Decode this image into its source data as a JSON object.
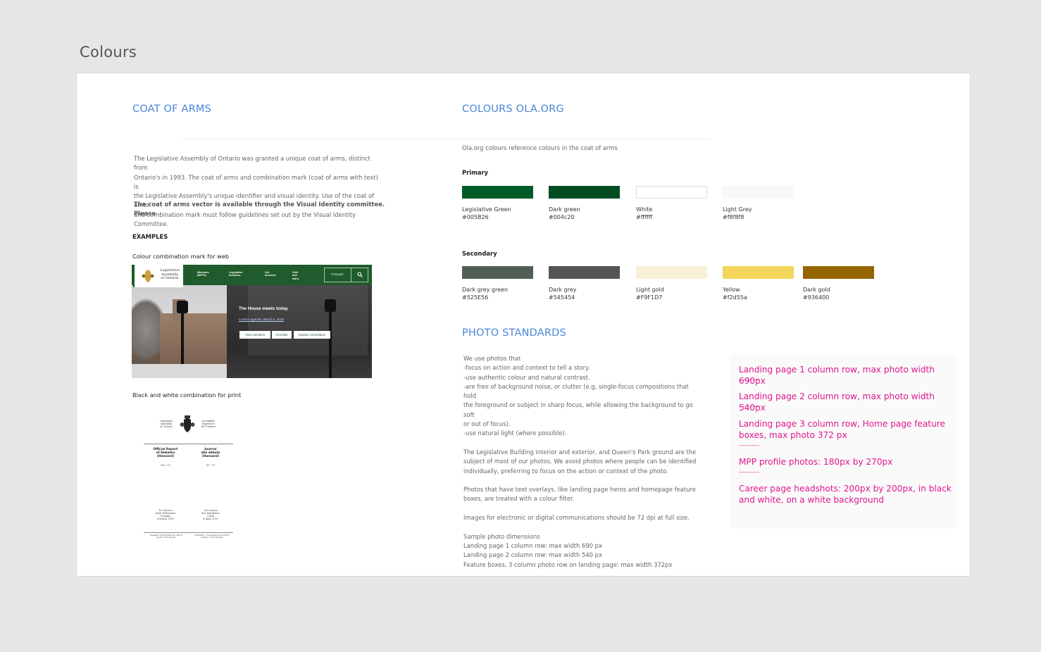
{
  "page": {
    "heading": "Colours"
  },
  "coat_of_arms": {
    "title": "COAT OF ARMS",
    "description": [
      "The Legislative Assembly of Ontario was granted a unique coat of arms, distinct from",
      "Ontario's in 1993. The coat of arms and combination mark (coat of arms with text) is",
      "the Legislative Assembly's unique identifier and visual identity.  Use of the coat of arms",
      "and combination mark must follow guidelines set out by the Visual Identity Committee."
    ],
    "vector_note": "The coat of arms vector is available through the Visual Identity committee. Please",
    "examples_heading": "EXAMPLES",
    "web_caption": "Colour combination mark for web",
    "print_caption": "Black and white combination for print"
  },
  "web_mockup": {
    "logo_lines": [
      "Legislative",
      "Assembly",
      "of Ontario"
    ],
    "nav": [
      [
        "Members",
        "(MPPs)"
      ],
      [
        "Legislative",
        "business"
      ],
      [
        "Get",
        "involved"
      ],
      [
        "Visit",
        "and",
        "learn"
      ]
    ],
    "search_label": "Français",
    "headline": "The House meets today.",
    "link": "Current agenda: March 5, 2019",
    "buttons": [
      "View members",
      "Find bills",
      "Explore committees"
    ],
    "accent": "#1f5b2c"
  },
  "print_mockup": {
    "left_header": [
      "Legislative",
      "Assembly",
      "of Ontario"
    ],
    "right_header": [
      "Assemblée",
      "législative",
      "de l'Ontario"
    ],
    "left_title": [
      "Official Report",
      "of Debates",
      "(Hansard)"
    ],
    "right_title": [
      "Journal",
      "des débats",
      "(Hansard)"
    ],
    "left_no": "No. 73",
    "right_no": "N° 73",
    "left_session": [
      "1st Session",
      "42nd Parliament",
      "Monday",
      "4 March 2019"
    ],
    "right_session": [
      "1re session",
      "42e législature",
      "Lundi",
      "4 mars 2019"
    ],
    "left_footer": [
      "Speaker: Honourable Ted Arnott",
      "Clerk: Todd Decker"
    ],
    "right_footer": [
      "Président : L'honorable Ted Arnott",
      "Greffier : Todd Decker"
    ]
  },
  "colours": {
    "title": "COLOURS OLA.ORG",
    "intro": "Ola.org colours reference colours in the coat of arms",
    "primary_label": "Primary",
    "primary": [
      {
        "name": "Legislative Green",
        "hex": "#005B26",
        "color": "#005B26"
      },
      {
        "name": "Dark green",
        "hex": "#004c20",
        "color": "#004c20"
      },
      {
        "name": "White",
        "hex": "#ffffff",
        "color": "#ffffff"
      },
      {
        "name": "Light Grey",
        "hex": "#f8f8f8",
        "color": "#f8f8f8"
      }
    ],
    "secondary_label": "Secondary",
    "secondary": [
      {
        "name": "Dark grey green",
        "hex": "#525E56",
        "color": "#525E56"
      },
      {
        "name": "Dark grey",
        "hex": "#545454",
        "color": "#545454"
      },
      {
        "name": "Light gold",
        "hex": "#F9F1D7",
        "color": "#F9F1D7"
      },
      {
        "name": "Yellow",
        "hex": "#f2d55a",
        "color": "#f2d55a"
      },
      {
        "name": "Dark gold",
        "hex": "#936400",
        "color": "#936400"
      }
    ]
  },
  "photo_standards": {
    "title": "PHOTO STANDARDS",
    "lines": [
      "We use photos that",
      "-focus on action and context to tell a story.",
      "-use authentic colour and natural contrast.",
      "-are free of background noise, or clutter (e.g, single-focus compositions that hold",
      "the foreground or subject in sharp focus, while allowing the background to go soft",
      "or out of focus).",
      "-use natural light (where possible).",
      "",
      "The Legislative Building interior and exterior, and Queen's Park ground are the",
      "subject of most of our photos. We avoid photos where people can be identified",
      "individually, preferring to focus on the action or context of the photo.",
      "",
      "Photos that have text overlays, like landing page heros and homepage feature",
      "boxes, are treated with a colour filter.",
      "",
      "Images for electronic or digital communications should be 72 dpi at full size.",
      "",
      "Sample photo dimensions",
      "Landing page 1 column row: max width 690 px",
      "Landing page 2 column row: max width 540 px",
      "Feature boxes, 3 column photo row on landing page: max width 372px"
    ]
  },
  "notes": {
    "items": [
      "Landing page 1 column row, max photo width 690px",
      "Landing page 2 column row, max photo width 540px",
      "Landing page 3 column row, Home page feature boxes, max photo 372 px",
      "MPP profile photos: 180px by 270px",
      "Career page headshots: 200px by 200px, in black and white, on a white background"
    ],
    "separator": "----------",
    "color": "#e0168f"
  }
}
